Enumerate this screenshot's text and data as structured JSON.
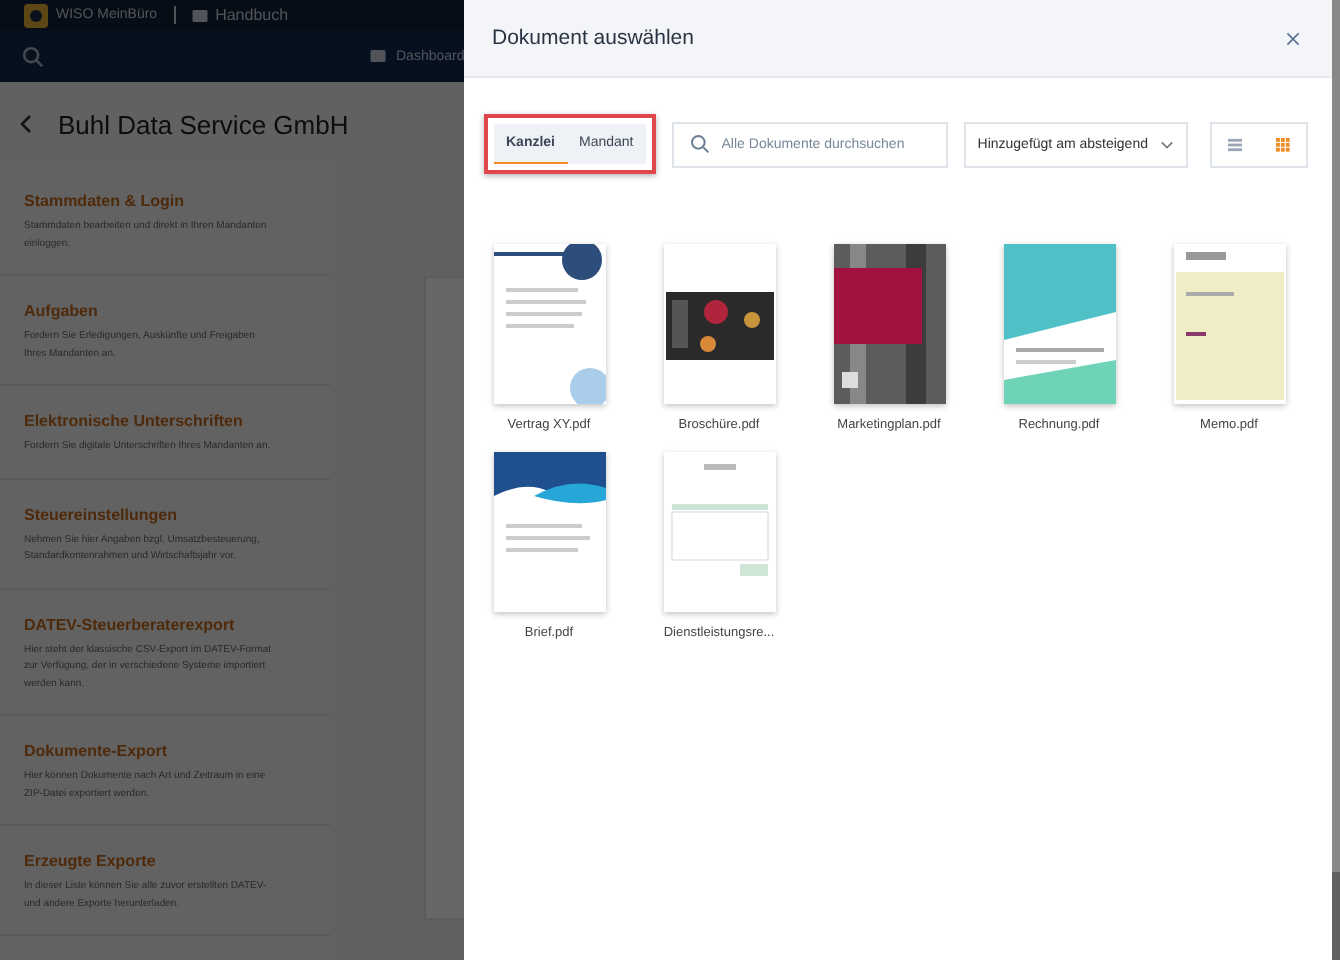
{
  "app": {
    "brand": "WISO MeinBüro",
    "section": "Handbuch",
    "nav_item": "Dashboard"
  },
  "page": {
    "title": "Buhl Data Service GmbH",
    "sections": [
      {
        "title": "Stammdaten & Login",
        "description": "Stammdaten bearbeiten und direkt in Ihren Mandanten einloggen."
      },
      {
        "title": "Aufgaben",
        "description": "Fordern Sie Erledigungen, Auskünfte und Freigaben Ihres Mandanten an."
      },
      {
        "title": "Elektronische Unterschriften",
        "description": "Fordern Sie digitale Unterschriften Ihres Mandanten an."
      },
      {
        "title": "Steuereinstellungen",
        "description": "Nehmen Sie hier Angaben bzgl. Umsatzbesteuerung, Standardkontenrahmen und Wirtschaftsjahr vor."
      },
      {
        "title": "DATEV-Steuerberaterexport",
        "description": "Hier steht der klassische CSV-Export im DATEV-Format zur Verfügung, der in verschiedene Systeme importiert werden kann."
      },
      {
        "title": "Dokumente-Export",
        "description": "Hier können Dokumente nach Art und Zeitraum in eine ZIP-Datei exportiert werden."
      },
      {
        "title": "Erzeugte Exporte",
        "description": "In dieser Liste können Sie alle zuvor erstellten DATEV- und andere Exporte herunterladen."
      }
    ]
  },
  "dialog": {
    "title": "Dokument auswählen",
    "source_tabs": [
      {
        "label": "Kanzlei",
        "selected": true
      },
      {
        "label": "Mandant",
        "selected": false
      }
    ],
    "search": {
      "placeholder": "Alle Dokumente durchsuchen"
    },
    "sort": {
      "value": "Hinzugefügt am absteigend"
    },
    "view_modes": [
      {
        "kind": "list",
        "selected": false
      },
      {
        "kind": "grid",
        "selected": true
      }
    ],
    "documents": [
      {
        "name": "Vertrag XY.pdf"
      },
      {
        "name": "Broschüre.pdf"
      },
      {
        "name": "Marketingplan.pdf"
      },
      {
        "name": "Rechnung.pdf"
      },
      {
        "name": "Memo.pdf"
      },
      {
        "name": "Brief.pdf"
      },
      {
        "name": "Dienstleistungsre..."
      }
    ]
  }
}
